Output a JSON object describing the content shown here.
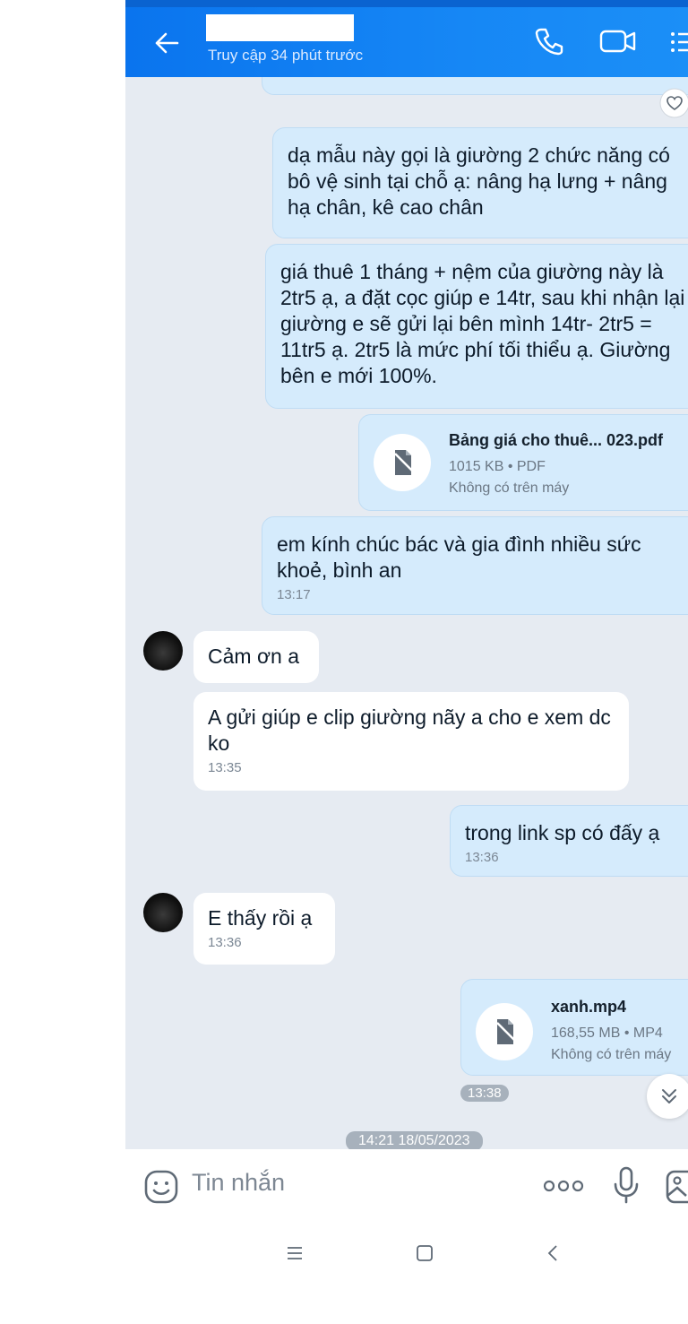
{
  "header": {
    "status": "Truy cập 34 phút trước"
  },
  "messages": {
    "m1": "dạ mẫu này gọi là giường 2 chức năng có bô vệ sinh tại chỗ ạ: nâng hạ lưng + nâng hạ chân, kê cao chân",
    "m2": "giá thuê 1 tháng + nệm của giường này là 2tr5 ạ, a đặt cọc giúp e 14tr, sau khi nhận lại giường e sẽ gửi lại bên mình 14tr- 2tr5 = 11tr5 ạ. 2tr5 là mức phí tối thiểu ạ. Giường bên e mới 100%.",
    "file1": {
      "name": "Bảng giá cho thuê... 023.pdf",
      "meta": "1015 KB • PDF",
      "status": "Không có trên máy"
    },
    "m3": {
      "text": "em kính chúc bác và gia đình nhiều sức khoẻ, bình an",
      "time": "13:17"
    },
    "r1": {
      "text": "Cảm ơn a"
    },
    "r2": {
      "text": "A gửi giúp e clip giường nãy a cho e xem dc ko",
      "time": "13:35"
    },
    "m4": {
      "text": "trong link sp có đấy ạ",
      "time": "13:36"
    },
    "r3": {
      "text": "E thấy rồi ạ",
      "time": "13:36"
    },
    "file2": {
      "name": "xanh.mp4",
      "meta": "168,55 MB • MP4",
      "status": "Không có trên máy",
      "time": "13:38"
    },
    "date_pill": "14:21 18/05/2023"
  },
  "input": {
    "placeholder": "Tin nhắn"
  },
  "icons": {
    "back": "arrow-left-icon",
    "call": "phone-icon",
    "video": "video-camera-icon",
    "menu": "list-menu-icon",
    "react": "heart-icon",
    "file": "file-icon",
    "scroll": "double-chevron-down-icon",
    "emoji": "emoji-icon",
    "more": "more-dots-icon",
    "mic": "microphone-icon",
    "image": "image-icon",
    "nav_menu": "recent-apps-icon",
    "nav_home": "home-icon",
    "nav_back": "nav-back-icon"
  },
  "colors": {
    "header": "#1687f5",
    "chat_bg": "#e6ebf2",
    "outgoing": "#d5ebfc",
    "incoming": "#ffffff"
  }
}
